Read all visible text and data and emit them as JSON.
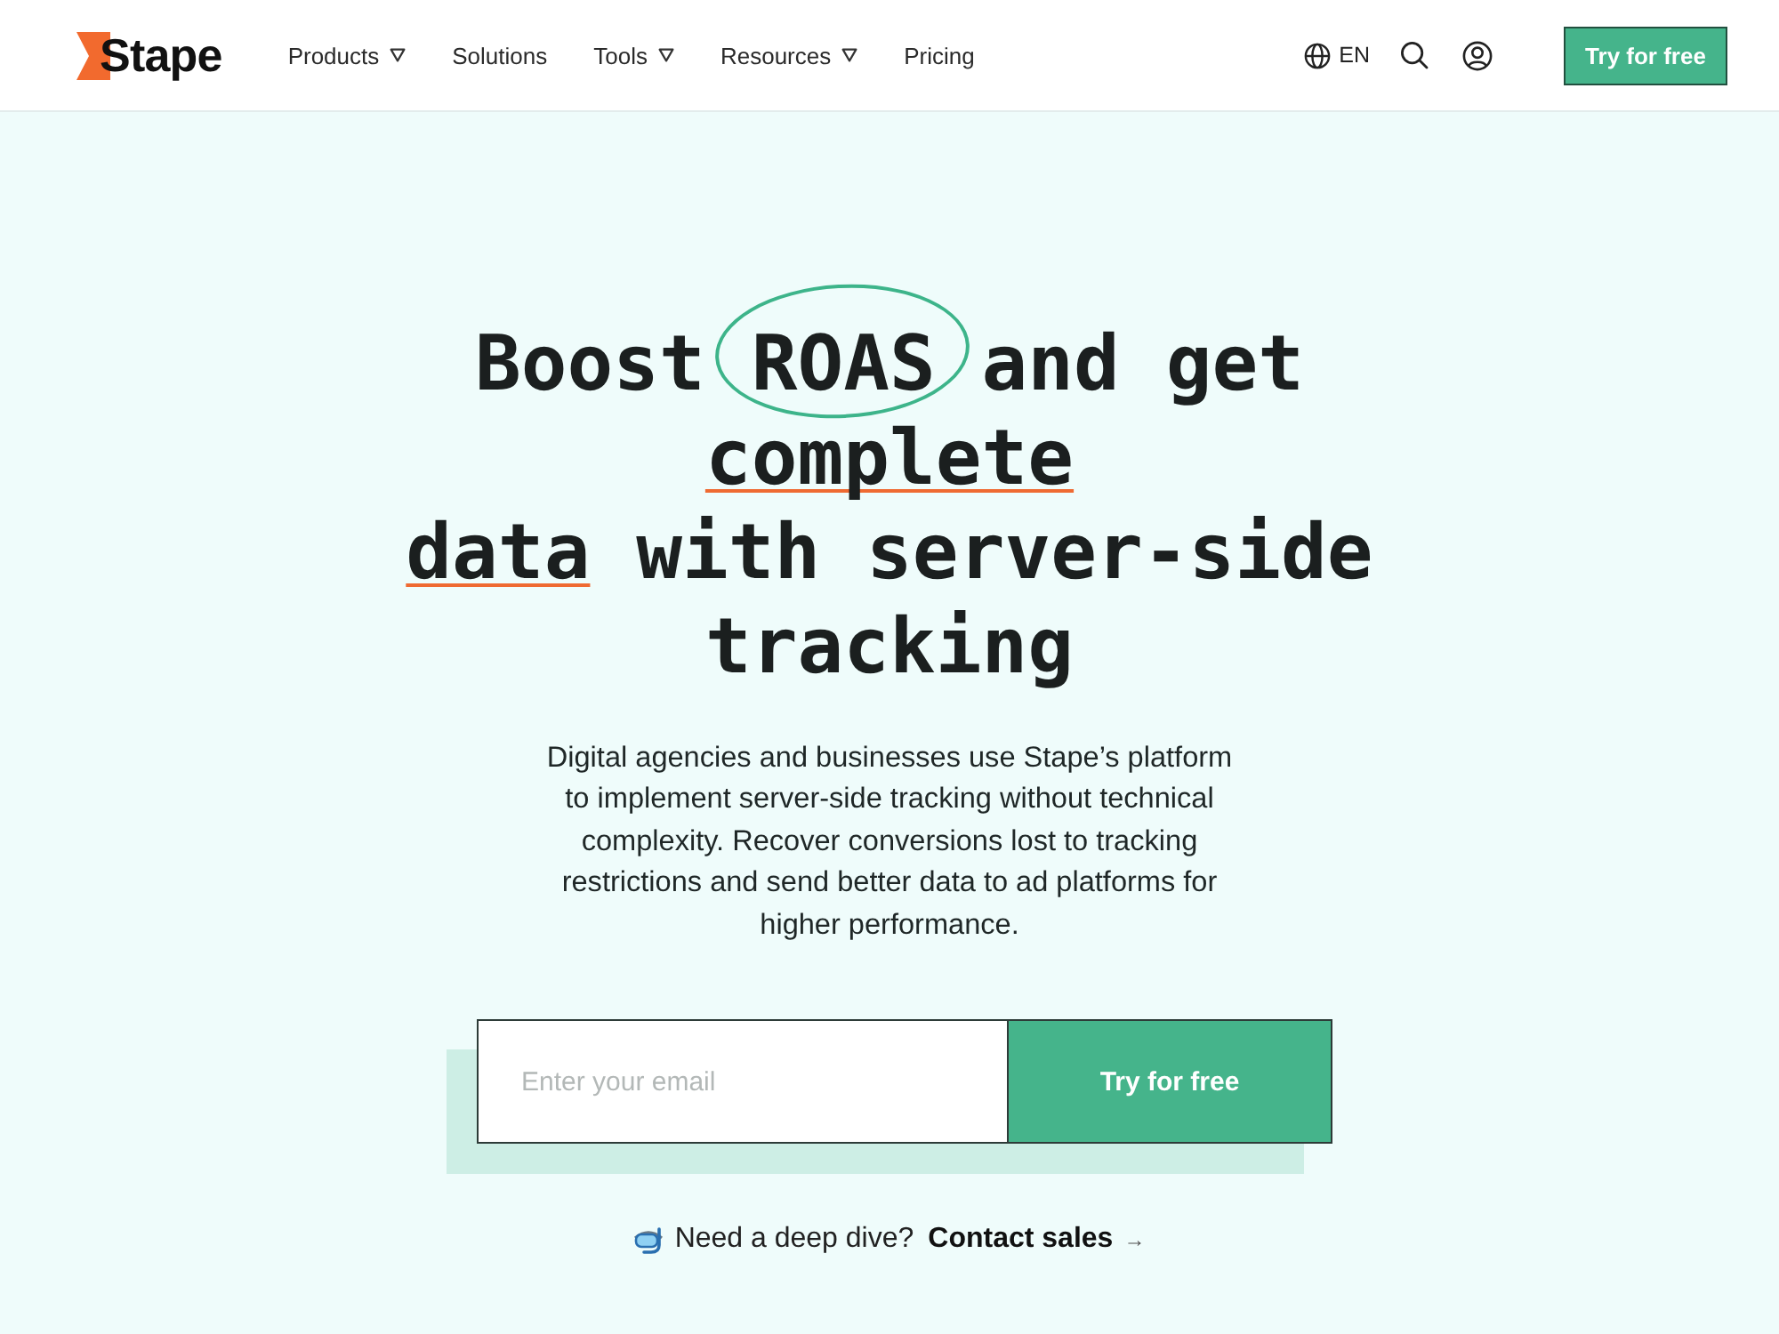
{
  "header": {
    "logo": {
      "text": "Stape"
    },
    "nav": [
      {
        "label": "Products",
        "dropdown": true
      },
      {
        "label": "Solutions",
        "dropdown": false
      },
      {
        "label": "Tools",
        "dropdown": true
      },
      {
        "label": "Resources",
        "dropdown": true
      },
      {
        "label": "Pricing",
        "dropdown": false
      }
    ],
    "language": {
      "code": "EN"
    },
    "cta_button": {
      "label": "Try for free"
    }
  },
  "hero": {
    "headline": {
      "lines": [
        [
          {
            "text": "Boost ",
            "kind": "plain"
          },
          {
            "text": "ROAS",
            "kind": "circled"
          },
          {
            "text": " and get ",
            "kind": "plain"
          },
          {
            "text": "complete",
            "kind": "underlined"
          }
        ],
        [
          {
            "text": "data",
            "kind": "underlined"
          },
          {
            "text": " with server-side tracking",
            "kind": "plain"
          }
        ]
      ]
    },
    "description": "Digital agencies and businesses use Stape’s platform to implement server-side tracking without technical complexity. Recover conversions lost to tracking restrictions and send better data to ad platforms for higher performance.",
    "signup": {
      "email": {
        "placeholder": "Enter your email"
      },
      "button": {
        "label": "Try for free"
      }
    },
    "contact": {
      "text": "Need a deep dive?",
      "link": "Contact sales",
      "arrow": "→"
    }
  }
}
